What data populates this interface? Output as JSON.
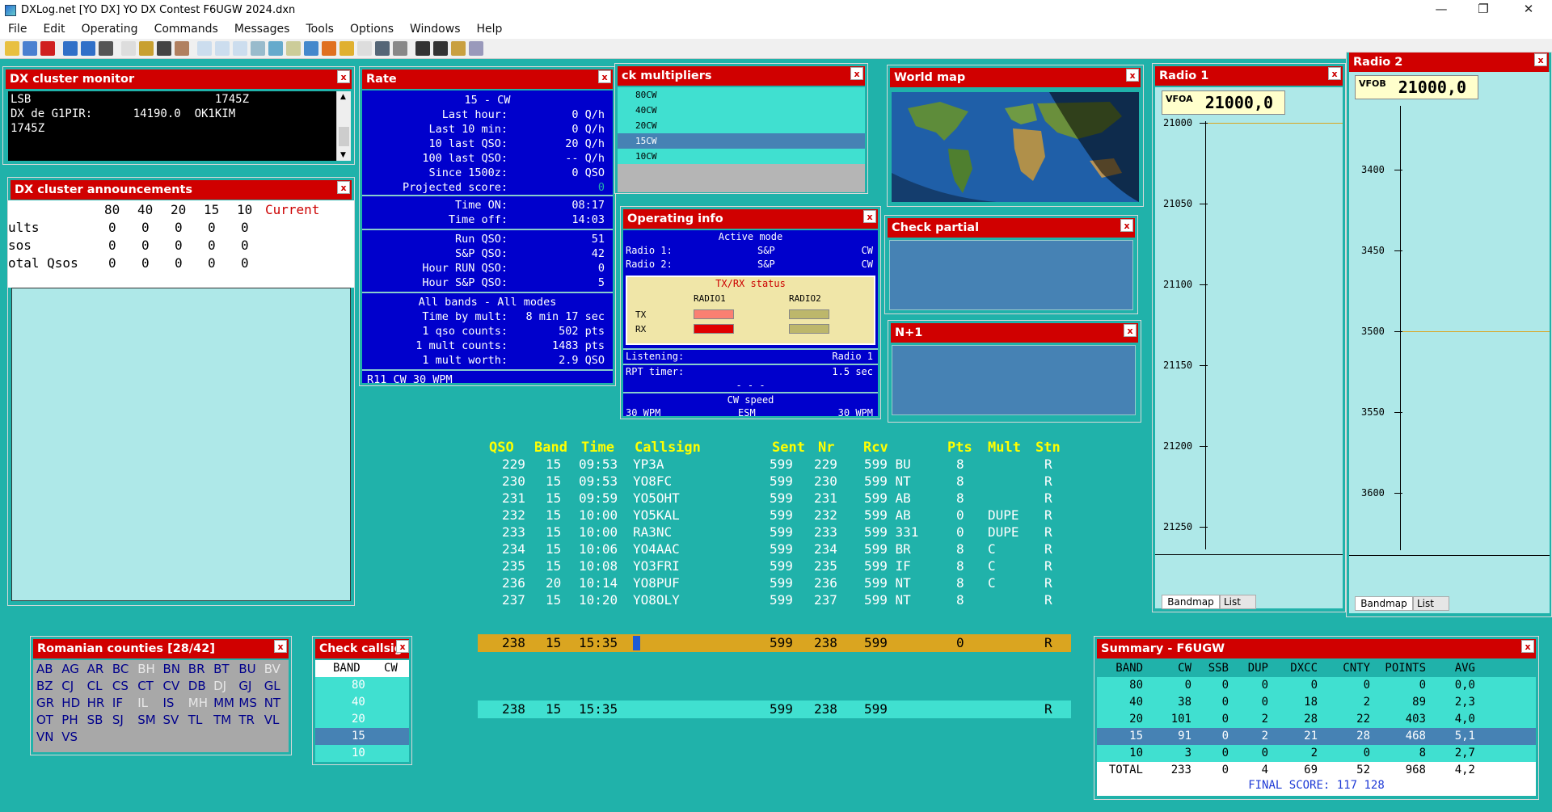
{
  "app": {
    "title": "DXLog.net [YO DX] YO DX Contest F6UGW 2024.dxn",
    "menu": [
      "File",
      "Edit",
      "Operating",
      "Commands",
      "Messages",
      "Tools",
      "Options",
      "Windows",
      "Help"
    ]
  },
  "dx_monitor": {
    "title": "DX cluster monitor",
    "lines": [
      "LSB                           1745Z",
      "DX de G1PIR:      14190.0  OK1KIM",
      "1745Z"
    ]
  },
  "dx_ann": {
    "title": "DX cluster announcements",
    "header": [
      "80",
      "40",
      "20",
      "15",
      "10",
      "Current"
    ],
    "rows": [
      {
        "label": "ults",
        "vals": [
          "0",
          "0",
          "0",
          "0",
          "0"
        ]
      },
      {
        "label": "sos",
        "vals": [
          "0",
          "0",
          "0",
          "0",
          "0"
        ]
      },
      {
        "label": "otal Qsos",
        "vals": [
          "0",
          "0",
          "0",
          "0",
          "0"
        ]
      }
    ]
  },
  "rate": {
    "title": "Rate",
    "band_mode": "15 - CW",
    "rows1": [
      [
        "Last hour:",
        "0 Q/h"
      ],
      [
        "Last 10 min:",
        "0 Q/h"
      ],
      [
        "10 last QSO:",
        "20 Q/h"
      ],
      [
        "100 last QSO:",
        "-- Q/h"
      ],
      [
        "Since 1500z:",
        "0 QSO"
      ],
      [
        "Projected score:",
        "0"
      ]
    ],
    "rows2": [
      [
        "Time ON:",
        "08:17"
      ],
      [
        "Time off:",
        "14:03"
      ]
    ],
    "rows3": [
      [
        "Run QSO:",
        "51"
      ],
      [
        "S&P QSO:",
        "42"
      ],
      [
        "Hour RUN QSO:",
        "0"
      ],
      [
        "Hour S&P QSO:",
        "5"
      ]
    ],
    "allbands": "All bands - All modes",
    "rows4": [
      [
        "Time by mult:",
        "8 min 17 sec"
      ],
      [
        "1 qso counts:",
        "502 pts"
      ],
      [
        "1 mult counts:",
        "1483 pts"
      ],
      [
        "1 mult worth:",
        "2.9 QSO"
      ]
    ],
    "status": "R11  CW 30 WPM"
  },
  "check_mult": {
    "title": "ck multipliers",
    "items": [
      "80CW",
      "40CW",
      "20CW",
      "15CW",
      "10CW"
    ]
  },
  "world_map": {
    "title": "World map"
  },
  "op_info": {
    "title": "Operating info",
    "active_mode": "Active mode",
    "radio1_label": "Radio 1:",
    "radio1_mode": "S&P",
    "radio1_op": "CW",
    "radio2_label": "Radio 2:",
    "radio2_mode": "S&P",
    "radio2_op": "CW",
    "txrx_title": "TX/RX status",
    "col1": "RADIO1",
    "col2": "RADIO2",
    "tx": "TX",
    "rx": "RX",
    "listening_label": "Listening:",
    "listening_val": "Radio 1",
    "rpt_label": "RPT timer:",
    "rpt_val": "1.5 sec",
    "dashes": "- - -",
    "cw_speed": "CW speed",
    "wpm1": "30 WPM",
    "esm": "ESM",
    "wpm2": "30 WPM"
  },
  "check_partial": {
    "title": "Check partial"
  },
  "n1": {
    "title": "N+1"
  },
  "radio1": {
    "title": "Radio 1",
    "vfo_label": "VFOA",
    "freq": "21000,0",
    "scale": [
      "21000",
      "21050",
      "21100",
      "21150",
      "21200",
      "21250"
    ],
    "tabs": [
      "Bandmap",
      "List"
    ]
  },
  "radio2": {
    "title": "Radio 2",
    "vfo_label": "VFOB",
    "freq": "21000,0",
    "scale": [
      "3400",
      "3450",
      "3500",
      "3550",
      "3600"
    ],
    "tabs": [
      "Bandmap",
      "List"
    ]
  },
  "log": {
    "headers": [
      "QSO",
      "Band",
      "Time",
      "Callsign",
      "Sent",
      "Nr",
      "Rcv",
      "Pts",
      "Mult",
      "Stn"
    ],
    "rows": [
      [
        "229",
        "15",
        "09:53",
        "YP3A",
        "599",
        "229",
        "599 BU",
        "8",
        "",
        "R"
      ],
      [
        "230",
        "15",
        "09:53",
        "YO8FC",
        "599",
        "230",
        "599 NT",
        "8",
        "",
        "R"
      ],
      [
        "231",
        "15",
        "09:59",
        "YO5OHT",
        "599",
        "231",
        "599 AB",
        "8",
        "",
        "R"
      ],
      [
        "232",
        "15",
        "10:00",
        "YO5KAL",
        "599",
        "232",
        "599 AB",
        "0",
        "DUPE",
        "R"
      ],
      [
        "233",
        "15",
        "10:00",
        "RA3NC",
        "599",
        "233",
        "599 331",
        "0",
        "DUPE",
        "R"
      ],
      [
        "234",
        "15",
        "10:06",
        "YO4AAC",
        "599",
        "234",
        "599 BR",
        "8",
        "C",
        "R"
      ],
      [
        "235",
        "15",
        "10:08",
        "YO3FRI",
        "599",
        "235",
        "599 IF",
        "8",
        "C",
        "R"
      ],
      [
        "236",
        "20",
        "10:14",
        "YO8PUF",
        "599",
        "236",
        "599 NT",
        "8",
        "C",
        "R"
      ],
      [
        "237",
        "15",
        "10:20",
        "YO8OLY",
        "599",
        "237",
        "599 NT",
        "8",
        "",
        "R"
      ]
    ],
    "entry": {
      "qso": "238",
      "band": "15",
      "time": "15:35",
      "sent": "599",
      "nr": "238",
      "rcv": "599",
      "pts": "0",
      "stn": "R"
    },
    "entry2": {
      "qso": "238",
      "band": "15",
      "time": "15:35",
      "sent": "599",
      "nr": "238",
      "rcv": "599",
      "stn": "R"
    }
  },
  "counties": {
    "title": "Romanian counties [28/42]",
    "rows": [
      [
        "AB",
        "AG",
        "AR",
        "BC",
        "BH",
        "BN",
        "BR",
        "BT",
        "BU",
        "BV"
      ],
      [
        "BZ",
        "CJ",
        "CL",
        "CS",
        "CT",
        "CV",
        "DB",
        "DJ",
        "GJ",
        "GL"
      ],
      [
        "GR",
        "HD",
        "HR",
        "IF",
        "IL",
        "IS",
        "MH",
        "MM",
        "MS",
        "NT"
      ],
      [
        "OT",
        "PH",
        "SB",
        "SJ",
        "SM",
        "SV",
        "TL",
        "TM",
        "TR",
        "VL"
      ],
      [
        "VN",
        "VS"
      ]
    ],
    "worked": [
      "AB",
      "AG",
      "AR",
      "BC",
      "BN",
      "BR",
      "BT",
      "BU",
      "BZ",
      "CJ",
      "CL",
      "CS",
      "CT",
      "CV",
      "DB",
      "GJ",
      "GL",
      "GR",
      "HD",
      "HR",
      "IF",
      "IS",
      "MM",
      "MS",
      "NT",
      "OT",
      "PH",
      "SB",
      "SJ",
      "SM",
      "SV",
      "TL",
      "TM",
      "TR",
      "VL",
      "VN",
      "VS"
    ]
  },
  "check_call": {
    "title": "Check callsign",
    "band_label": "BAND",
    "mode_label": "CW",
    "bands": [
      "80",
      "40",
      "20",
      "15",
      "10"
    ]
  },
  "summary": {
    "title": "Summary - F6UGW",
    "headers": [
      "BAND",
      "CW",
      "SSB",
      "DUP",
      "DXCC",
      "CNTY",
      "POINTS",
      "AVG"
    ],
    "rows": [
      [
        "80",
        "0",
        "0",
        "0",
        "0",
        "0",
        "0",
        "0,0"
      ],
      [
        "40",
        "38",
        "0",
        "0",
        "18",
        "2",
        "89",
        "2,3"
      ],
      [
        "20",
        "101",
        "0",
        "2",
        "28",
        "22",
        "403",
        "4,0"
      ],
      [
        "15",
        "91",
        "0",
        "2",
        "21",
        "28",
        "468",
        "5,1"
      ],
      [
        "10",
        "3",
        "0",
        "0",
        "2",
        "0",
        "8",
        "2,7"
      ],
      [
        "TOTAL",
        "233",
        "0",
        "4",
        "69",
        "52",
        "968",
        "4,2"
      ]
    ],
    "final": "FINAL SCORE: 117 128"
  },
  "colors": {
    "bg": "#20B2AA",
    "title_red": "#d00000",
    "panel_blue": "#0000cc",
    "log_yellow": "#ffff00",
    "entry_orange": "#DAA520"
  }
}
